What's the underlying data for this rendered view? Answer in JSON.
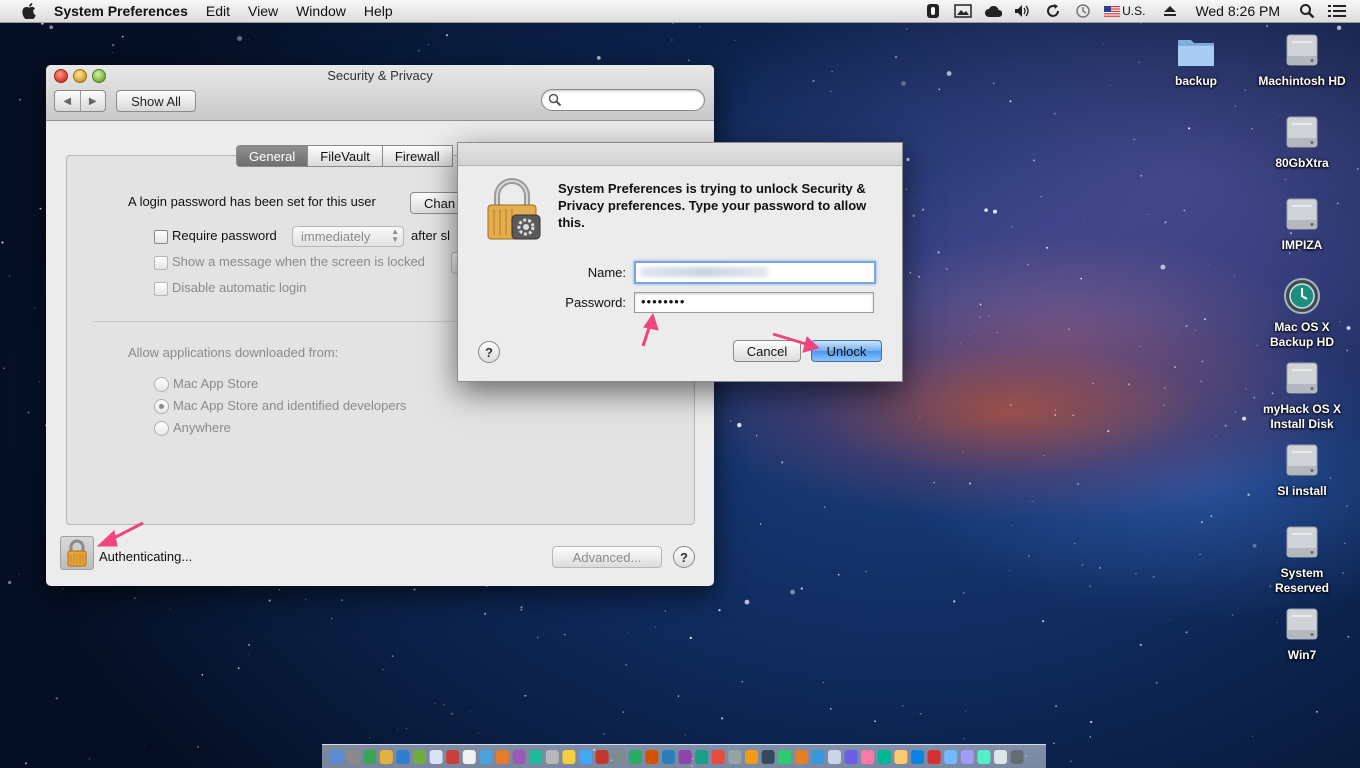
{
  "menubar": {
    "app_name": "System Preferences",
    "menus": [
      "Edit",
      "View",
      "Window",
      "Help"
    ],
    "input_source": "U.S.",
    "clock": "Wed 8:26 PM"
  },
  "desktop": {
    "icons": [
      {
        "label": "backup",
        "kind": "folder-icon"
      },
      {
        "label": "Machintosh HD",
        "kind": "hard-drive-icon"
      },
      {
        "label": "80GbXtra",
        "kind": "hard-drive-icon"
      },
      {
        "label": "IMPIZA",
        "kind": "hard-drive-icon"
      },
      {
        "label": "Mac OS X Backup HD",
        "kind": "time-machine-icon"
      },
      {
        "label": "myHack OS X Install Disk",
        "kind": "hard-drive-icon"
      },
      {
        "label": "SI install",
        "kind": "hard-drive-icon"
      },
      {
        "label": "System Reserved",
        "kind": "hard-drive-icon"
      },
      {
        "label": "Win7",
        "kind": "hard-drive-icon"
      }
    ]
  },
  "window": {
    "title": "Security & Privacy",
    "show_all": "Show All",
    "search_placeholder": "",
    "tabs": [
      {
        "label": "General",
        "selected": true
      },
      {
        "label": "FileVault",
        "selected": false
      },
      {
        "label": "Firewall",
        "selected": false
      }
    ],
    "general": {
      "login_text": "A login password has been set for this user",
      "change_button": "Chan",
      "require_password": "Require password",
      "require_interval": "immediately",
      "after_sleep": "after sl",
      "show_message": "Show a message when the screen is locked",
      "disable_auto_login": "Disable automatic login",
      "allow_apps_label": "Allow applications downloaded from:",
      "options": [
        "Mac App Store",
        "Mac App Store and identified developers",
        "Anywhere"
      ],
      "selected_option": "Mac App Store and identified developers"
    },
    "status": "Authenticating...",
    "advanced_button": "Advanced...",
    "help_label": "?"
  },
  "dialog": {
    "message": "System Preferences is trying to unlock Security & Privacy preferences. Type your password to allow this.",
    "name_label": "Name:",
    "password_label": "Password:",
    "password_value": "••••••••",
    "help_label": "?",
    "cancel": "Cancel",
    "unlock": "Unlock"
  },
  "colors": {
    "annotation_arrow": "#f0457f",
    "default_button": "#4a97ec",
    "focus_ring": "#7aa6df"
  }
}
